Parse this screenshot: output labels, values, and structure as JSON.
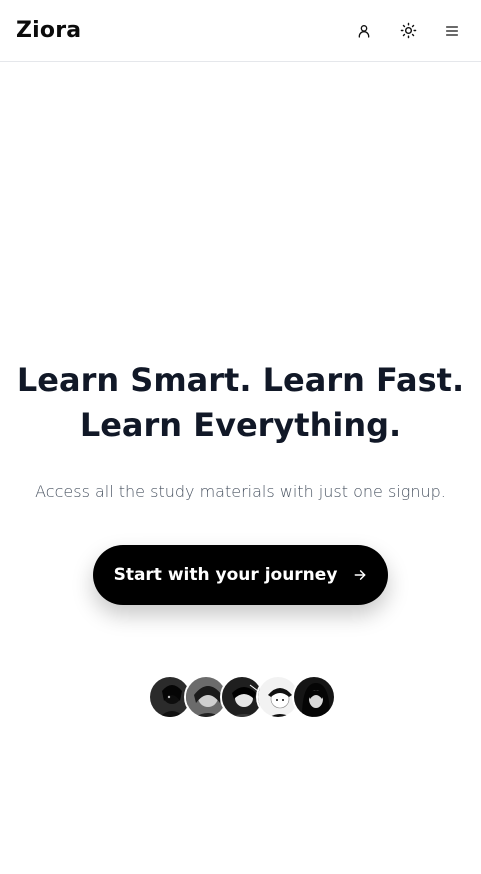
{
  "header": {
    "logo": "Ziora",
    "icons": [
      "user-icon",
      "sun-icon",
      "menu-icon"
    ]
  },
  "hero": {
    "headline_line1": "Learn Smart. Learn Fast.",
    "headline_line2": "Learn Everything.",
    "subtitle": "Access all the study materials with just one signup.",
    "cta_label": "Start with your journey"
  },
  "avatars": {
    "count": 5
  },
  "colors": {
    "background": "#ffffff",
    "text": "#111827",
    "muted": "#4b5563",
    "cta_bg": "#000000",
    "cta_text": "#ffffff",
    "divider": "#e5e7eb"
  }
}
